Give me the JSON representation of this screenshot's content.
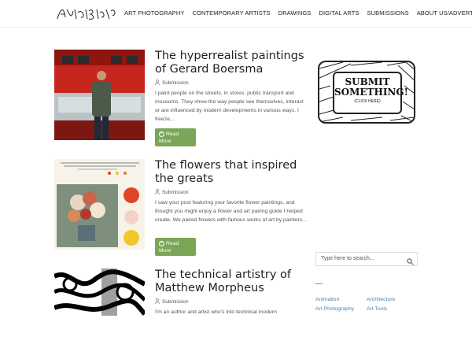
{
  "header": {
    "logo_text": "Artists & Art",
    "nav": [
      "Art Photography",
      "Contemporary Artists",
      "Drawings",
      "Digital Arts",
      "Submissions",
      "About Us/Advertise"
    ]
  },
  "posts": [
    {
      "title": "The hyperrealist paintings of Gerard Boersma",
      "author": "Submission",
      "excerpt": "I paint people on the streets, in stores, public transport and museums. They show the way people see themselves, interact or are influenced by modern developments in various ways. I freeze...",
      "read_more": "Read More"
    },
    {
      "title": "The flowers that inspired the greats",
      "author": "Submission",
      "excerpt": "I saw your post featuring your favorite flower paintings, and thought you might enjoy a flower and art pairing guide I helped create. We paired flowers with famous works of art by painters...",
      "read_more": "Read More"
    },
    {
      "title": "The technical artistry of Matthew Morpheus",
      "author": "Submission",
      "excerpt": "I'm an author and artist who's into technical modern"
    }
  ],
  "sidebar": {
    "ad": {
      "title": "SUBMIT SOMETHING!",
      "sub": "(CLICK HERE)"
    },
    "search_placeholder": "Type here to search...",
    "categories": [
      "Animation",
      "Architecture",
      "Art Photography",
      "Art Tools"
    ]
  },
  "colors": {
    "accent_green": "#7aa657",
    "link_blue": "#4a86b8"
  }
}
